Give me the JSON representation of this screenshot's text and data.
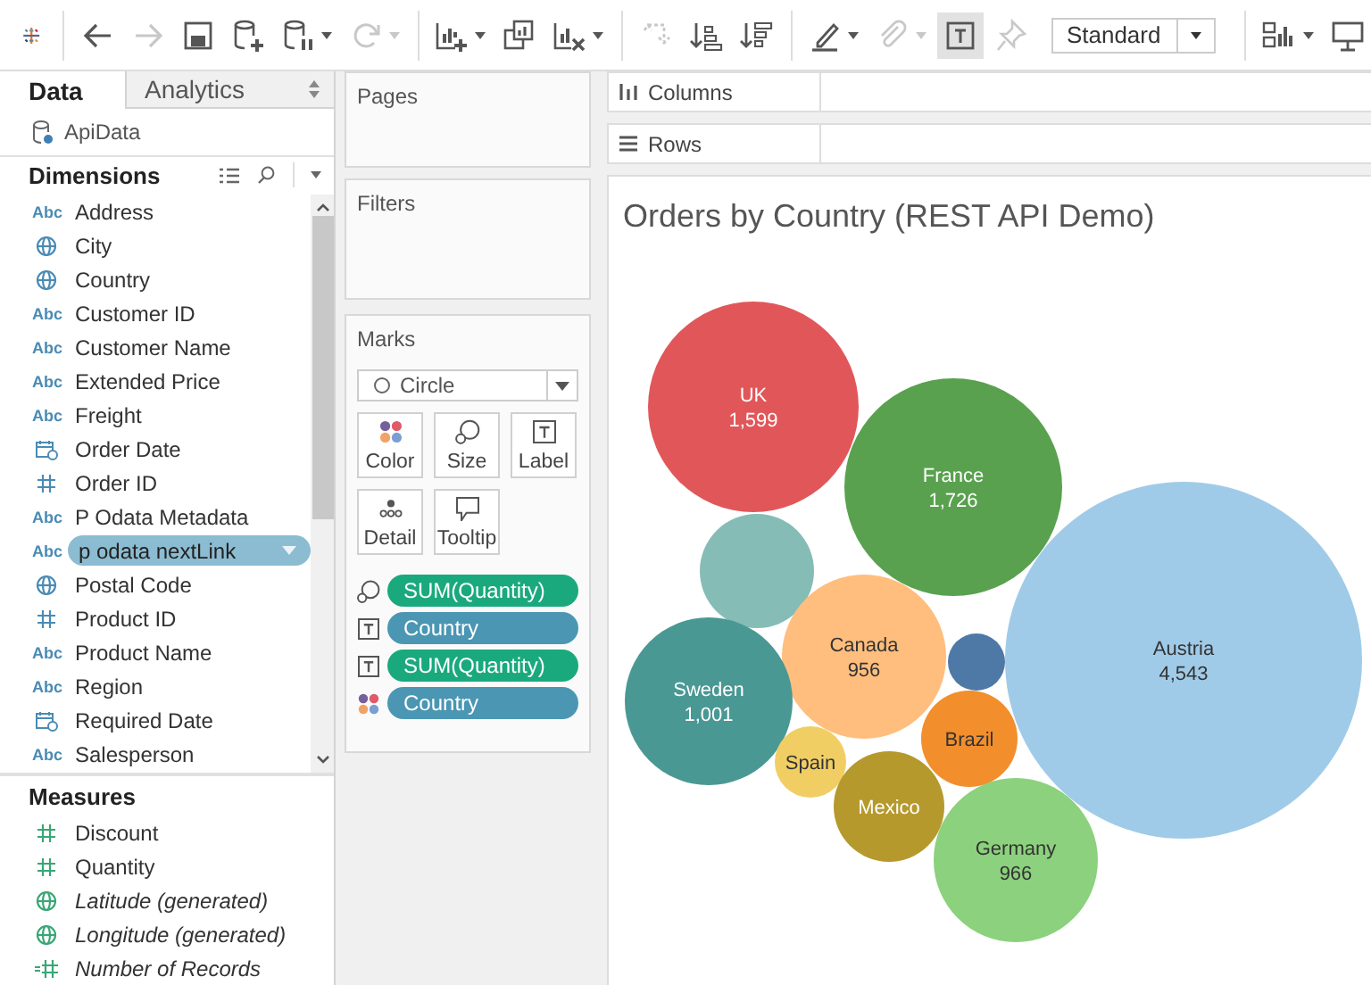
{
  "toolbar": {
    "items": [
      {
        "kind": "logo"
      },
      {
        "kind": "sep"
      },
      {
        "kind": "back",
        "disabled": false,
        "pressed": false,
        "caret": false
      },
      {
        "kind": "forward",
        "disabled": true,
        "pressed": false,
        "caret": false
      },
      {
        "kind": "save",
        "disabled": false,
        "pressed": false,
        "caret": false
      },
      {
        "kind": "add-source",
        "disabled": false,
        "pressed": false,
        "caret": false
      },
      {
        "kind": "pause",
        "disabled": false,
        "pressed": false,
        "caret": true
      },
      {
        "kind": "refresh",
        "disabled": true,
        "pressed": false,
        "caret": true
      },
      {
        "kind": "sep"
      },
      {
        "kind": "new-sheet",
        "disabled": false,
        "pressed": false,
        "caret": true
      },
      {
        "kind": "duplicate",
        "disabled": false,
        "pressed": false,
        "caret": false
      },
      {
        "kind": "clear",
        "disabled": false,
        "pressed": false,
        "caret": true
      },
      {
        "kind": "sep"
      },
      {
        "kind": "swap",
        "disabled": true,
        "pressed": false,
        "caret": false
      },
      {
        "kind": "sort-asc",
        "disabled": false,
        "pressed": false,
        "caret": false
      },
      {
        "kind": "sort-desc",
        "disabled": false,
        "pressed": false,
        "caret": false
      },
      {
        "kind": "sep"
      },
      {
        "kind": "highlight",
        "disabled": false,
        "pressed": false,
        "caret": true
      },
      {
        "kind": "attach",
        "disabled": true,
        "pressed": false,
        "caret": true
      },
      {
        "kind": "labels",
        "disabled": false,
        "pressed": true,
        "caret": false
      },
      {
        "kind": "pin",
        "disabled": true,
        "pressed": false,
        "caret": false
      },
      {
        "kind": "view-size"
      },
      {
        "kind": "sep"
      },
      {
        "kind": "show-me",
        "disabled": false,
        "pressed": false,
        "caret": true
      },
      {
        "kind": "present",
        "disabled": false,
        "pressed": false,
        "caret": false
      }
    ],
    "view_size": "Standard"
  },
  "tabs": [
    {
      "label": "Data",
      "selected": true
    },
    {
      "label": "Analytics",
      "selected": false
    }
  ],
  "data_source": "ApiData",
  "dimensions": {
    "title": "Dimensions",
    "fields": [
      {
        "name": "Address",
        "kind": "string",
        "badge": "Abc",
        "selected": false
      },
      {
        "name": "City",
        "kind": "geo",
        "selected": false
      },
      {
        "name": "Country",
        "kind": "geo",
        "selected": false
      },
      {
        "name": "Customer ID",
        "kind": "string",
        "badge": "Abc",
        "selected": false
      },
      {
        "name": "Customer Name",
        "kind": "string",
        "badge": "Abc",
        "selected": false
      },
      {
        "name": "Extended Price",
        "kind": "string",
        "badge": "Abc",
        "selected": false
      },
      {
        "name": "Freight",
        "kind": "string",
        "badge": "Abc",
        "selected": false
      },
      {
        "name": "Order Date",
        "kind": "date",
        "selected": false
      },
      {
        "name": "Order ID",
        "kind": "number",
        "selected": false
      },
      {
        "name": "P Odata Metadata",
        "kind": "string",
        "badge": "Abc",
        "selected": false
      },
      {
        "name": "p odata nextLink",
        "kind": "string",
        "badge": "Abc",
        "selected": true
      },
      {
        "name": "Postal Code",
        "kind": "geo",
        "selected": false
      },
      {
        "name": "Product ID",
        "kind": "number",
        "selected": false
      },
      {
        "name": "Product Name",
        "kind": "string",
        "badge": "Abc",
        "selected": false
      },
      {
        "name": "Region",
        "kind": "string",
        "badge": "Abc",
        "selected": false
      },
      {
        "name": "Required Date",
        "kind": "date",
        "selected": false
      },
      {
        "name": "Salesperson",
        "kind": "string",
        "badge": "Abc",
        "selected": false
      }
    ]
  },
  "measures": {
    "title": "Measures",
    "fields": [
      {
        "name": "Discount",
        "kind": "number",
        "generated": false
      },
      {
        "name": "Quantity",
        "kind": "number",
        "generated": false
      },
      {
        "name": "Latitude (generated)",
        "kind": "geo",
        "generated": true
      },
      {
        "name": "Longitude (generated)",
        "kind": "geo",
        "generated": true
      },
      {
        "name": "Number of Records",
        "kind": "calc-number",
        "generated": true
      }
    ]
  },
  "pages": {
    "title": "Pages"
  },
  "filters": {
    "title": "Filters"
  },
  "marks": {
    "title": "Marks",
    "mark_type": "Circle",
    "buttons": [
      {
        "label": "Color",
        "kind": "color"
      },
      {
        "label": "Size",
        "kind": "size"
      },
      {
        "label": "Label",
        "kind": "label"
      },
      {
        "label": "Detail",
        "kind": "detail"
      },
      {
        "label": "Tooltip",
        "kind": "tooltip"
      }
    ],
    "pills": [
      {
        "label": "SUM(Quantity)",
        "kind": "measure"
      },
      {
        "label": "Country",
        "kind": "dimension"
      },
      {
        "label": "SUM(Quantity)",
        "kind": "measure"
      },
      {
        "label": "Country",
        "kind": "dimension"
      }
    ]
  },
  "columns": {
    "label": "Columns"
  },
  "rows": {
    "label": "Rows"
  },
  "chart": {
    "title": "Orders by Country (REST API Demo)",
    "bubbles": [
      {
        "label": "UK",
        "value": "1,599",
        "color": "#e15759"
      },
      {
        "label": "France",
        "value": "1,726",
        "color": "#59a14f"
      },
      {
        "color": "#86bcb6"
      },
      {
        "label": "Canada",
        "value": "956",
        "color": "#ffbe7d"
      },
      {
        "color": "#4e79a7"
      },
      {
        "label": "Austria",
        "value": "4,543",
        "color": "#a0cbe8"
      },
      {
        "label": "Sweden",
        "value": "1,001",
        "color": "#499894"
      },
      {
        "label": "Brazil",
        "color": "#f28e2b"
      },
      {
        "label": "Spain",
        "color": "#f1ce63"
      },
      {
        "label": "Mexico",
        "color": "#b6992d"
      },
      {
        "label": "Germany",
        "value": "966",
        "color": "#8cd17d"
      }
    ]
  }
}
